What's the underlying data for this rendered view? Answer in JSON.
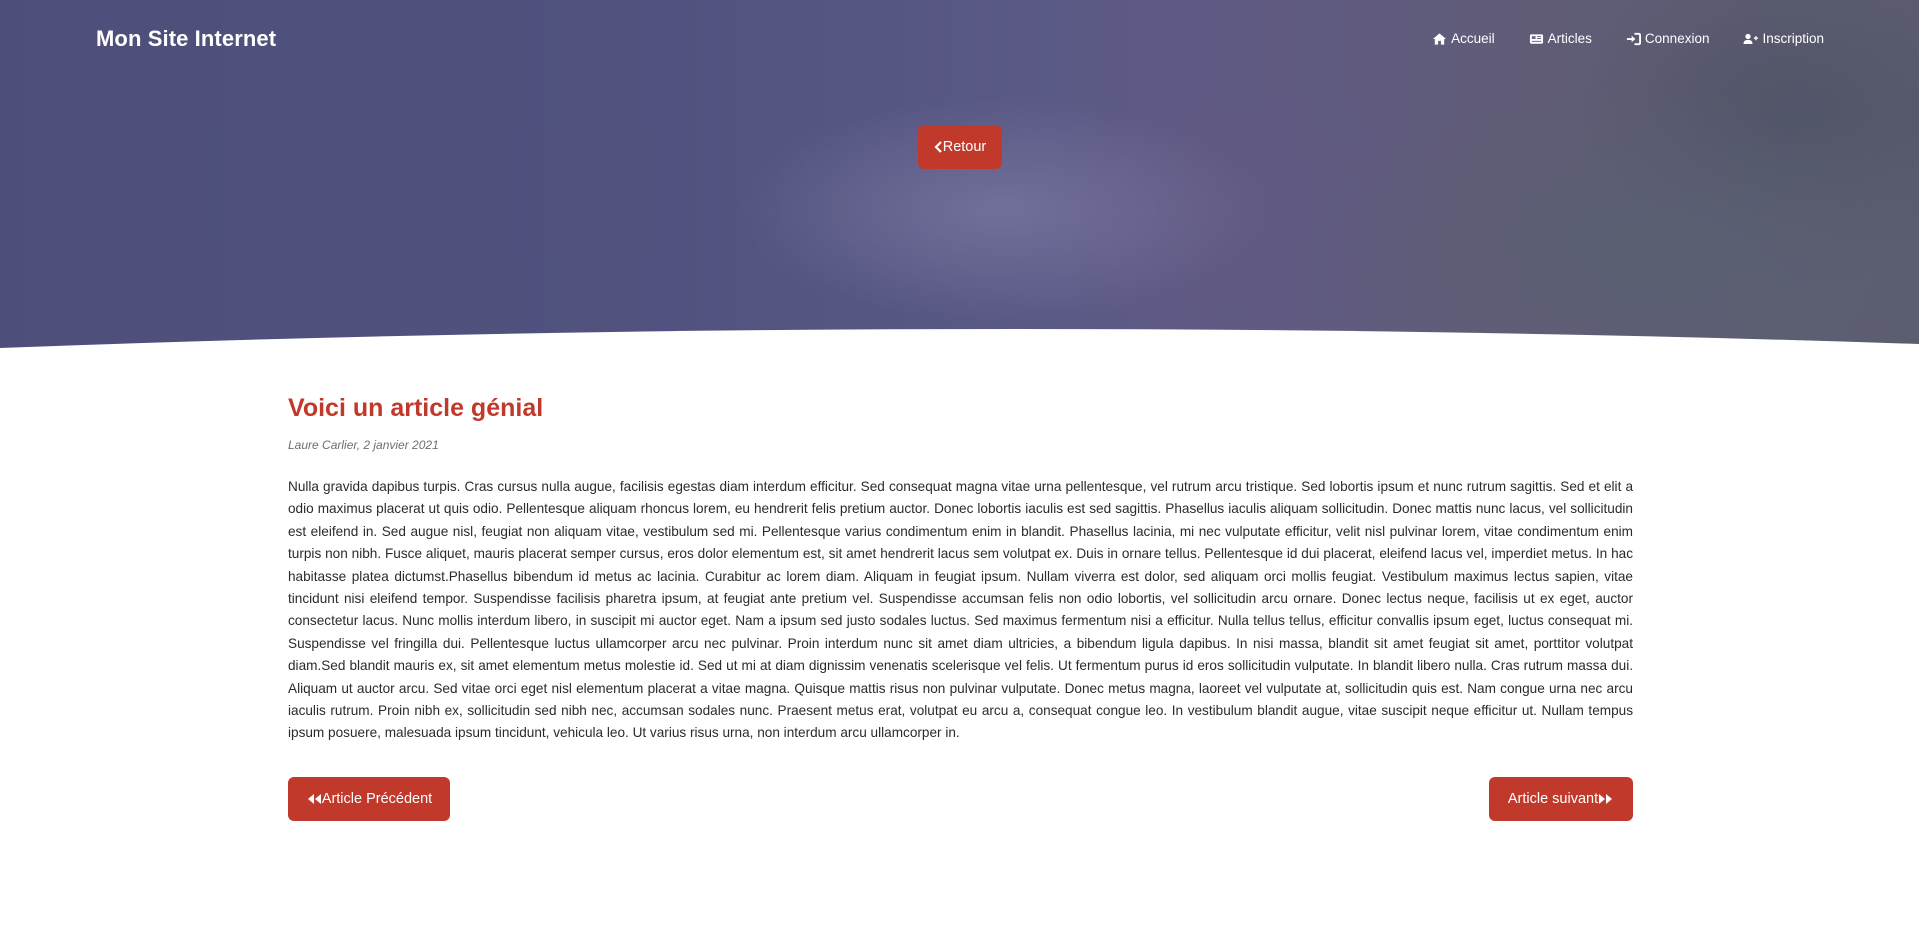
{
  "header": {
    "brand": "Mon Site Internet",
    "nav": [
      {
        "label": "Accueil",
        "icon": "home-icon"
      },
      {
        "label": "Articles",
        "icon": "newspaper-icon"
      },
      {
        "label": "Connexion",
        "icon": "sign-in-icon"
      },
      {
        "label": "Inscription",
        "icon": "user-plus-icon"
      }
    ]
  },
  "hero": {
    "back_label": "Retour",
    "back_icon": "chevron-left-icon"
  },
  "article": {
    "title": "Voici un article génial",
    "meta": "Laure Carlier, 2 janvier 2021",
    "body": "Nulla gravida dapibus turpis. Cras cursus nulla augue, facilisis egestas diam interdum efficitur. Sed consequat magna vitae urna pellentesque, vel rutrum arcu tristique. Sed lobortis ipsum et nunc rutrum sagittis. Sed et elit a odio maximus placerat ut quis odio. Pellentesque aliquam rhoncus lorem, eu hendrerit felis pretium auctor. Donec lobortis iaculis est sed sagittis. Phasellus iaculis aliquam sollicitudin. Donec mattis nunc lacus, vel sollicitudin est eleifend in. Sed augue nisl, feugiat non aliquam vitae, vestibulum sed mi. Pellentesque varius condimentum enim in blandit. Phasellus lacinia, mi nec vulputate efficitur, velit nisl pulvinar lorem, vitae condimentum enim turpis non nibh. Fusce aliquet, mauris placerat semper cursus, eros dolor elementum est, sit amet hendrerit lacus sem volutpat ex. Duis in ornare tellus. Pellentesque id dui placerat, eleifend lacus vel, imperdiet metus. In hac habitasse platea dictumst.Phasellus bibendum id metus ac lacinia. Curabitur ac lorem diam. Aliquam in feugiat ipsum. Nullam viverra est dolor, sed aliquam orci mollis feugiat. Vestibulum maximus lectus sapien, vitae tincidunt nisi eleifend tempor. Suspendisse facilisis pharetra ipsum, at feugiat ante pretium vel. Suspendisse accumsan felis non odio lobortis, vel sollicitudin arcu ornare. Donec lectus neque, facilisis ut ex eget, auctor consectetur lacus. Nunc mollis interdum libero, in suscipit mi auctor eget. Nam a ipsum sed justo sodales luctus. Sed maximus fermentum nisi a efficitur. Nulla tellus tellus, efficitur convallis ipsum eget, luctus consequat mi. Suspendisse vel fringilla dui. Pellentesque luctus ullamcorper arcu nec pulvinar. Proin interdum nunc sit amet diam ultricies, a bibendum ligula dapibus. In nisi massa, blandit sit amet feugiat sit amet, porttitor volutpat diam.Sed blandit mauris ex, sit amet elementum metus molestie id. Sed ut mi at diam dignissim venenatis scelerisque vel felis. Ut fermentum purus id eros sollicitudin vulputate. In blandit libero nulla. Cras rutrum massa dui. Aliquam ut auctor arcu. Sed vitae orci eget nisl elementum placerat a vitae magna. Quisque mattis risus non pulvinar vulputate. Donec metus magna, laoreet vel vulputate at, sollicitudin quis est. Nam congue urna nec arcu iaculis rutrum. Proin nibh ex, sollicitudin sed nibh nec, accumsan sodales nunc. Praesent metus erat, volutpat eu arcu a, consequat congue leo. In vestibulum blandit augue, vitae suscipit neque efficitur ut. Nullam tempus ipsum posuere, malesuada ipsum tincidunt, vehicula leo. Ut varius risus urna, non interdum arcu ullamcorper in."
  },
  "pager": {
    "prev_label": "Article Précédent",
    "prev_icon": "backward-icon",
    "next_label": "Article suivant",
    "next_icon": "forward-icon"
  },
  "colors": {
    "accent": "#c0392b",
    "hero_overlay": "#584e8a",
    "text": "#2b2b2b",
    "meta": "#6f6f6f"
  }
}
